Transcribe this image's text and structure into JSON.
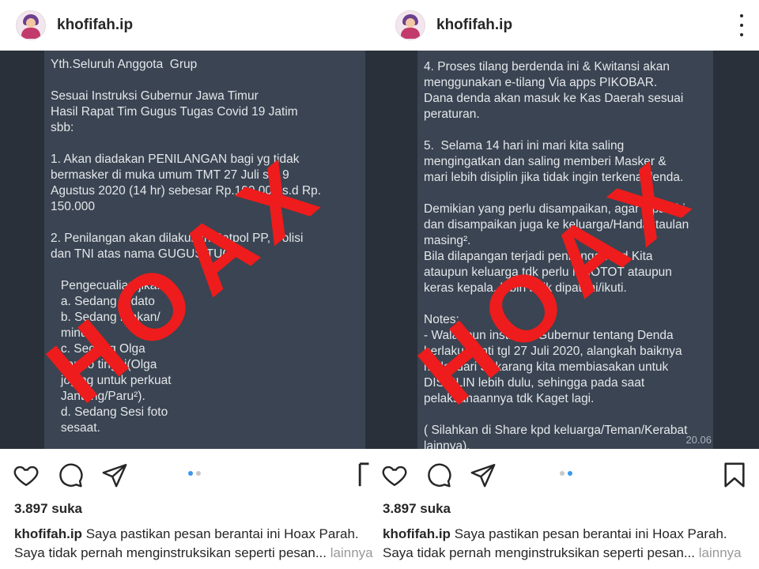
{
  "left": {
    "username": "khofifah.ip",
    "message_lines": [
      "Yth.Seluruh Anggota  Grup",
      "",
      "Sesuai Instruksi Gubernur Jawa Timur",
      "Hasil Rapat Tim Gugus Tugas Covid 19 Jatim",
      "sbb:",
      "",
      "1. Akan diadakan PENILANGAN bagi yg tidak",
      "bermasker di muka umum TMT 27 Juli s/d 9",
      "Agustus 2020 (14 hr) sebesar Rp.100.000 s.d Rp.",
      "150.000",
      "",
      "2. Penilangan akan dilakukan Satpol PP, Polisi",
      "dan TNI atas nama GUGUS TUGAS.",
      "",
      "   Pengecualian jika:",
      "   a. Sedang Pidato",
      "   b. Sedang makan/",
      "   minum",
      "   c. Sedang Olga",
      "   kardio tinggi(Olga",
      "   joging untuk perkuat",
      "   Jantung/Paru²).",
      "   d. Sedang Sesi foto",
      "   sesaat."
    ],
    "stamp": "HOAX",
    "likes": "3.897 suka",
    "caption_user": "khofifah.ip",
    "caption_line1": "Saya pastikan pesan berantai ini Hoax Parah.",
    "caption_line2": "Saya tidak pernah menginstruksikan seperti pesan...",
    "more": "lainnya"
  },
  "right": {
    "username": "khofifah.ip",
    "message_lines": [
      "4. Proses tilang berdenda ini & Kwitansi akan",
      "menggunakan e-tilang Via apps PIKOBAR.",
      "Dana denda akan masuk ke Kas Daerah sesuai",
      "peraturan.",
      "",
      "5.  Selama 14 hari ini mari kita saling",
      "mengingatkan dan saling memberi Masker &",
      "mari lebih disiplin jika tidak ingin terkena denda.",
      "",
      "Demikian yang perlu disampaikan, agar dipatuhi",
      "dan disampaikan juga ke keluarga/Handai taulan",
      "masing².",
      "Bila dilapangan terjadi penilangan thd Kita",
      "ataupun keluarga tdk perlu NGOTOT ataupun",
      "keras kepala, lebih baik dipatuhi/ikuti.",
      "",
      "Notes:",
      "- Walaupun instruksi Gubernur tentang Denda",
      "berlaku nanti tgl 27 Juli 2020, alangkah baiknya",
      "mulai dari Sekarang kita membiasakan untuk",
      "DISIPLIN lebih dulu, sehingga pada saat",
      "pelaksanaannya tdk Kaget lagi.",
      "",
      "( Silahkan di Share kpd keluarga/Teman/Kerabat",
      "lainnya)."
    ],
    "time": "20.06",
    "stamp": "HOAX",
    "likes": "3.897 suka",
    "caption_user": "khofifah.ip",
    "caption_line1": "Saya pastikan pesan berantai ini Hoax Parah.",
    "caption_line2": "Saya tidak pernah menginstruksikan seperti pesan...",
    "more": "lainnya"
  },
  "colors": {
    "stamp": "#ee1c1c",
    "chat_bg": "#2a3039",
    "bubble": "#3a4452",
    "active_dot": "#3897f0"
  },
  "icons": [
    "heart-icon",
    "comment-icon",
    "send-icon",
    "bookmark-icon",
    "more-icon"
  ]
}
